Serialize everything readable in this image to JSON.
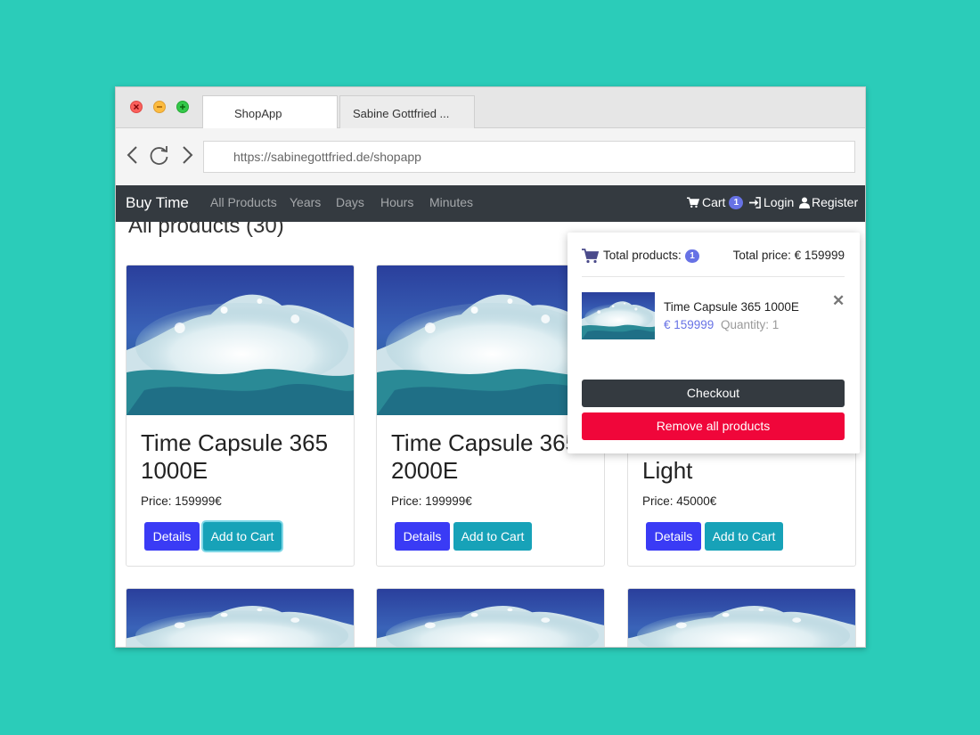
{
  "browser": {
    "tabs": [
      {
        "label": "ShopApp",
        "active": true
      },
      {
        "label": "Sabine Gottfried ...",
        "active": false
      }
    ],
    "url": "https://sabinegottfried.de/shopapp"
  },
  "navbar": {
    "brand": "Buy Time",
    "links": [
      "All Products",
      "Years",
      "Days",
      "Hours",
      "Minutes"
    ],
    "cart_label": "Cart",
    "cart_count": "1",
    "login_label": "Login",
    "register_label": "Register"
  },
  "main": {
    "heading": "All products (30)",
    "products": [
      {
        "title": "Time Capsule 365 1000E",
        "price": "Price: 159999€",
        "details": "Details",
        "add": "Add to Cart"
      },
      {
        "title": "Time Capsule 365 2000E",
        "price": "Price: 199999€",
        "details": "Details",
        "add": "Add to Cart"
      },
      {
        "title": "Light",
        "price": "Price: 45000€",
        "details": "Details",
        "add": "Add to Cart"
      }
    ]
  },
  "cart_popup": {
    "total_products_label": "Total products:",
    "total_products_count": "1",
    "total_price": "Total price: € 159999",
    "item": {
      "name": "Time Capsule 365 1000E",
      "price": "€ 159999",
      "quantity": "Quantity: 1"
    },
    "checkout_label": "Checkout",
    "remove_all_label": "Remove all products"
  },
  "colors": {
    "background": "#2bccb9",
    "navbar": "#343a40",
    "badge": "#6772e5",
    "details_button": "#3a3bf5",
    "add_button": "#17a2b8",
    "remove_button": "#f0063a"
  }
}
